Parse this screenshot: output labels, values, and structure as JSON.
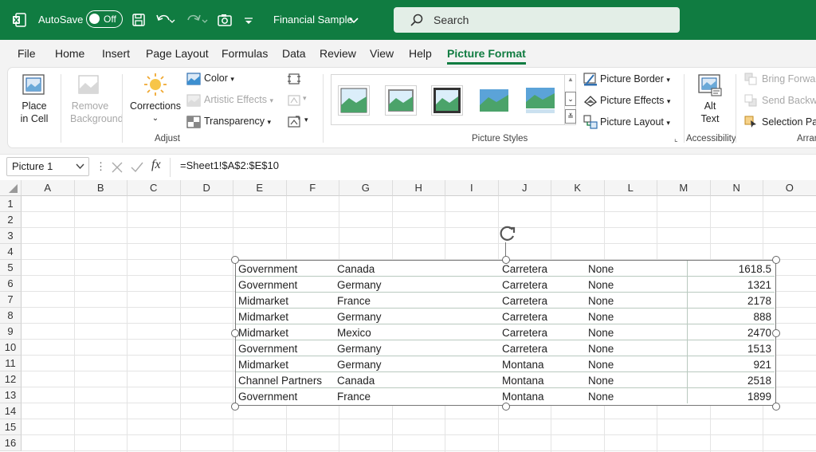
{
  "titlebar": {
    "autosave_label": "AutoSave",
    "autosave_state": "Off",
    "filename": "Financial Sample",
    "search_placeholder": "Search",
    "bg_color": "#107c41"
  },
  "menu": [
    "File",
    "Home",
    "Insert",
    "Page Layout",
    "Formulas",
    "Data",
    "Review",
    "View",
    "Help",
    "Picture Format"
  ],
  "menu_active": "Picture Format",
  "ribbon": {
    "place_in_cell": [
      "Place",
      "in Cell"
    ],
    "remove_background": [
      "Remove",
      "Background"
    ],
    "corrections": "Corrections",
    "color": "Color",
    "artistic_effects": "Artistic Effects",
    "transparency": "Transparency",
    "adjust_label": "Adjust",
    "picture_styles_label": "Picture Styles",
    "picture_border": "Picture Border",
    "picture_effects": "Picture Effects",
    "picture_layout": "Picture Layout",
    "alt_text": [
      "Alt",
      "Text"
    ],
    "accessibility_label": "Accessibility",
    "bring_forward": "Bring Forward",
    "send_backward": "Send Backward",
    "selection_pane": "Selection Pane",
    "arrange_label": "Arrange"
  },
  "formula_bar": {
    "name_box": "Picture 1",
    "fx": "fx",
    "formula": "=Sheet1!$A$2:$E$10"
  },
  "grid": {
    "columns": [
      "A",
      "B",
      "C",
      "D",
      "E",
      "F",
      "G",
      "H",
      "I",
      "J",
      "K",
      "L",
      "M",
      "N",
      "O"
    ],
    "rows": [
      "1",
      "2",
      "3",
      "4",
      "5",
      "6",
      "7",
      "8",
      "9",
      "10",
      "11",
      "12",
      "13",
      "14",
      "15",
      "16"
    ]
  },
  "picture_table": [
    [
      "Government",
      "Canada",
      "Carretera",
      "None",
      "1618.5"
    ],
    [
      "Government",
      "Germany",
      "Carretera",
      "None",
      "1321"
    ],
    [
      "Midmarket",
      "France",
      "Carretera",
      "None",
      "2178"
    ],
    [
      "Midmarket",
      "Germany",
      "Carretera",
      "None",
      "888"
    ],
    [
      "Midmarket",
      "Mexico",
      "Carretera",
      "None",
      "2470"
    ],
    [
      "Government",
      "Germany",
      "Carretera",
      "None",
      "1513"
    ],
    [
      "Midmarket",
      "Germany",
      "Montana",
      "None",
      "921"
    ],
    [
      "Channel Partners",
      "Canada",
      "Montana",
      "None",
      "2518"
    ],
    [
      "Government",
      "France",
      "Montana",
      "None",
      "1899"
    ]
  ]
}
